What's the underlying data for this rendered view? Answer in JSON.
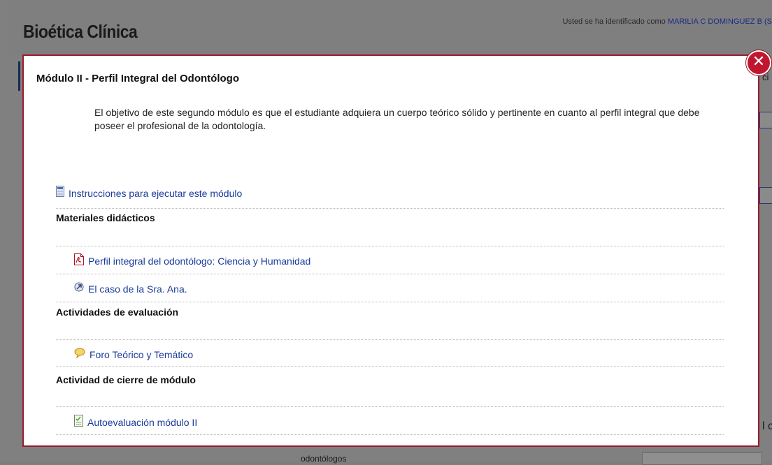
{
  "background": {
    "site_title": "Bioética Clínica",
    "login_prefix": "Usted se ha identificado como ",
    "login_user": "MARILIA C DOMINGUEZ B (S",
    "partial_right_top": "ci",
    "partial_right_bottom": "l c",
    "partial_bottom_text": "odontólogos"
  },
  "modal": {
    "title": "Módulo II - Perfil Integral del Odontólogo",
    "description": "El objetivo de este segundo módulo es que el estudiante adquiera un cuerpo teórico sólido y pertinente en cuanto al perfil integral que debe poseer el profesional de la odontología.",
    "close_icon": "close-icon",
    "instructions_link": "Instrucciones para ejecutar este módulo",
    "sections": [
      {
        "heading": "Materiales didácticos",
        "items": [
          {
            "label": "Perfil integral del odontólogo: Ciencia y Humanidad",
            "icon": "pdf-icon"
          },
          {
            "label": "El caso de la Sra. Ana.",
            "icon": "url-icon"
          }
        ]
      },
      {
        "heading": "Actividades de evaluación",
        "items": [
          {
            "label": "Foro Teórico y Temático",
            "icon": "forum-icon"
          }
        ]
      },
      {
        "heading": "Actividad de cierre de módulo",
        "items": [
          {
            "label": "Autoevaluación módulo II",
            "icon": "quiz-icon"
          }
        ]
      }
    ]
  },
  "colors": {
    "overlay": "#808080",
    "modal_border": "#9a1b2e",
    "close_button": "#c0172f",
    "link": "#1a3b9a"
  }
}
